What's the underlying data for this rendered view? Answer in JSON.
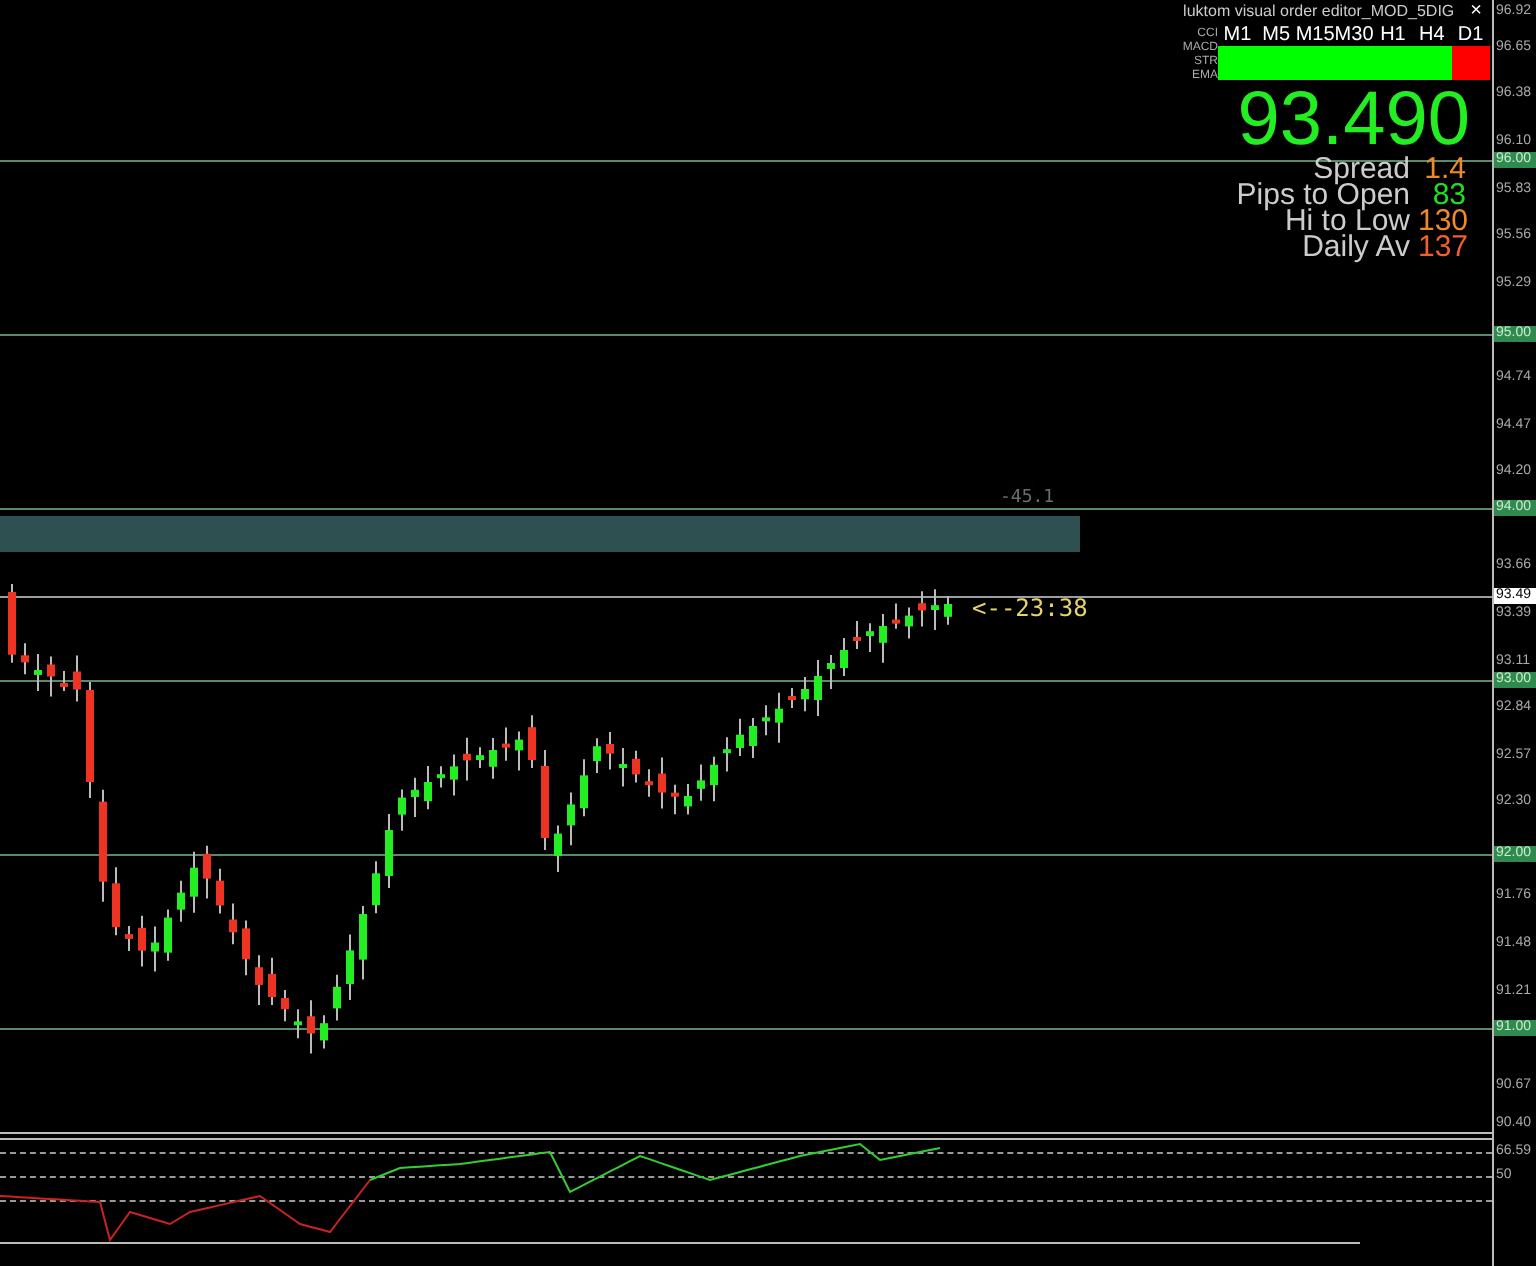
{
  "panel": {
    "title": "luktom visual order editor_MOD_5DIG",
    "close": "×",
    "indicators": [
      "CCI",
      "MACD",
      "STR",
      "EMA"
    ],
    "timeframes": [
      {
        "label": "M1",
        "color": "#00ff00"
      },
      {
        "label": "M5",
        "color": "#00ff00"
      },
      {
        "label": "M15",
        "color": "#00ff00"
      },
      {
        "label": "M30",
        "color": "#00ff00"
      },
      {
        "label": "H1",
        "color": "#00ff00"
      },
      {
        "label": "H4",
        "color": "#00ff00"
      },
      {
        "label": "D1",
        "color": "#ff0000"
      }
    ],
    "price": "93.490",
    "stats": [
      {
        "label": "Spread",
        "value": "1.4",
        "color": "#f08a24"
      },
      {
        "label": "Pips to Open",
        "value": "83",
        "color": "#22dd22"
      },
      {
        "label": "Hi to Low",
        "value": "130",
        "color": "#f08a24"
      },
      {
        "label": "Daily Av",
        "value": "137",
        "color": "#f0602a"
      }
    ]
  },
  "chart": {
    "zone_label": "-45.1",
    "countdown": "<--23:38"
  },
  "price_axis": [
    {
      "label": "96.92",
      "kind": "tick"
    },
    {
      "label": "96.65",
      "kind": "tick"
    },
    {
      "label": "96.38",
      "kind": "tick"
    },
    {
      "label": "96.10",
      "kind": "tick"
    },
    {
      "label": "96.00",
      "kind": "level"
    },
    {
      "label": "95.83",
      "kind": "tick"
    },
    {
      "label": "95.56",
      "kind": "tick"
    },
    {
      "label": "95.29",
      "kind": "tick"
    },
    {
      "label": "95.00",
      "kind": "level"
    },
    {
      "label": "94.74",
      "kind": "tick"
    },
    {
      "label": "94.47",
      "kind": "tick"
    },
    {
      "label": "94.20",
      "kind": "tick"
    },
    {
      "label": "94.00",
      "kind": "level"
    },
    {
      "label": "93.66",
      "kind": "tick"
    },
    {
      "label": "93.49",
      "kind": "current"
    },
    {
      "label": "93.39",
      "kind": "tick"
    },
    {
      "label": "93.11",
      "kind": "tick"
    },
    {
      "label": "93.00",
      "kind": "level"
    },
    {
      "label": "92.84",
      "kind": "tick"
    },
    {
      "label": "92.57",
      "kind": "tick"
    },
    {
      "label": "92.30",
      "kind": "tick"
    },
    {
      "label": "92.00",
      "kind": "level"
    },
    {
      "label": "91.76",
      "kind": "tick"
    },
    {
      "label": "91.48",
      "kind": "tick"
    },
    {
      "label": "91.21",
      "kind": "tick"
    },
    {
      "label": "91.00",
      "kind": "level"
    },
    {
      "label": "90.67",
      "kind": "tick"
    },
    {
      "label": "90.40",
      "kind": "tick"
    }
  ],
  "indicator_axis": [
    "66.59",
    "50"
  ]
}
